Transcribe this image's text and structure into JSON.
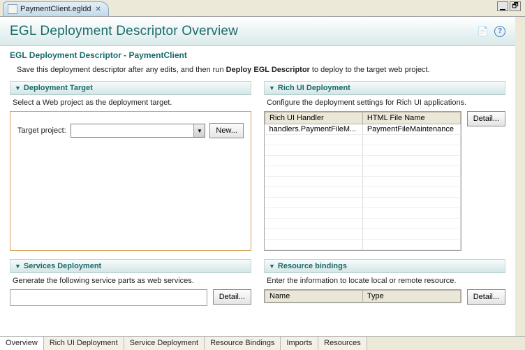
{
  "fileTab": {
    "name": "PaymentClient.egldd"
  },
  "windowControls": {
    "minimize": "▢",
    "maximize": "🗗"
  },
  "header": {
    "title": "EGL Deployment Descriptor Overview",
    "exportIcon": "export-icon",
    "helpIcon": "help-icon"
  },
  "subHeader": "EGL Deployment Descriptor - PaymentClient",
  "subDescParts": {
    "before": "Save this deployment descriptor after any edits, and then run ",
    "bold": "Deploy EGL Descriptor",
    "after": " to deploy to the target web project."
  },
  "deploymentTarget": {
    "title": "Deployment Target",
    "desc": "Select a Web project as the deployment target.",
    "label": "Target project:",
    "value": "",
    "newButton": "New..."
  },
  "richUI": {
    "title": "Rich UI Deployment",
    "desc": "Configure the deployment settings for Rich UI applications.",
    "detailButton": "Detail...",
    "columns": [
      "Rich UI Handler",
      "HTML File Name"
    ],
    "rows": [
      {
        "handler": "handlers.PaymentFileM...",
        "html": "PaymentFileMaintenance"
      }
    ],
    "emptyRows": 11
  },
  "services": {
    "title": "Services Deployment",
    "desc": "Generate the following service parts as web services.",
    "detailButton": "Detail..."
  },
  "bindings": {
    "title": "Resource bindings",
    "desc": "Enter the information to locate local or remote resource.",
    "detailButton": "Detail...",
    "columns": [
      "Name",
      "Type"
    ]
  },
  "bottomTabs": [
    "Overview",
    "Rich UI Deployment",
    "Service Deployment",
    "Resource Bindings",
    "Imports",
    "Resources"
  ],
  "activeBottomTab": 0
}
